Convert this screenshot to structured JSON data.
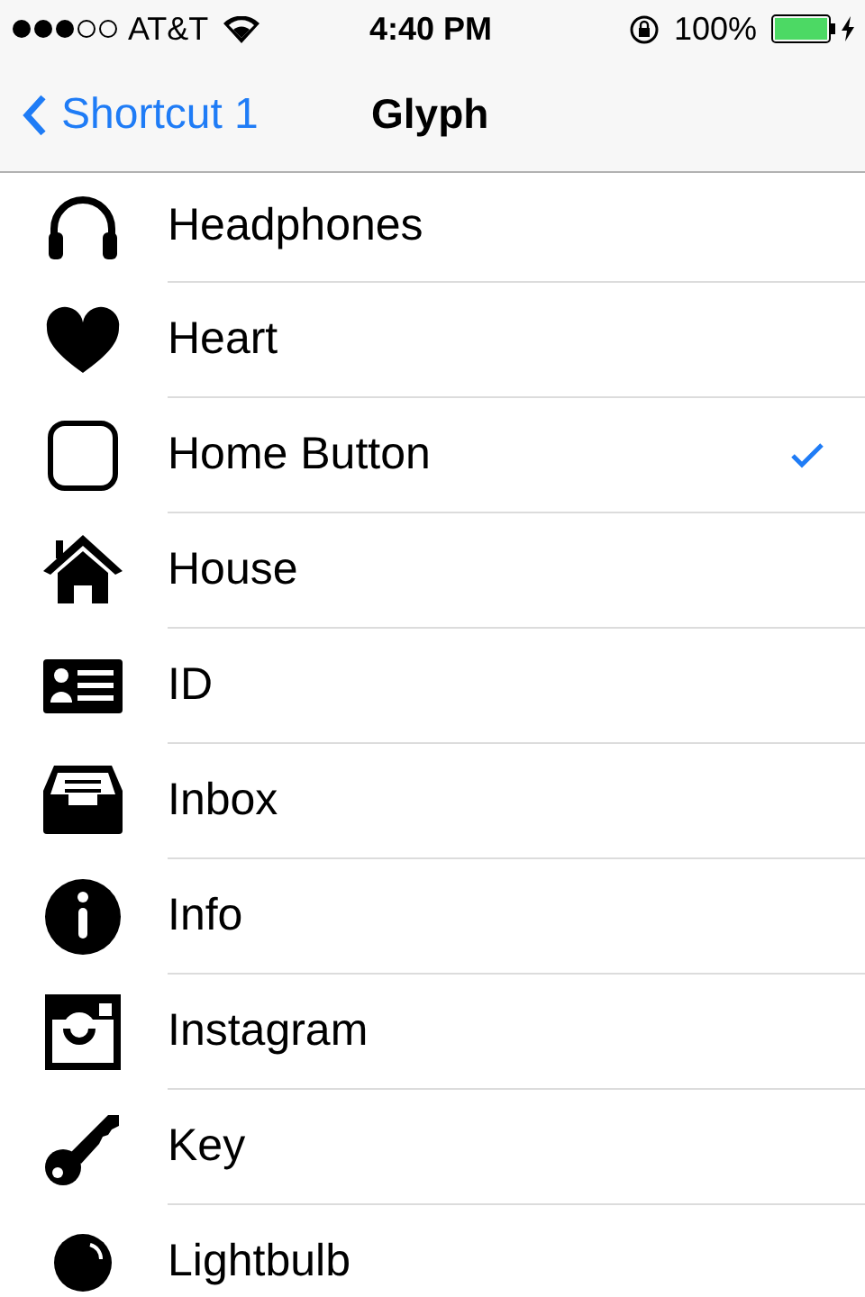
{
  "status_bar": {
    "carrier": "AT&T",
    "time": "4:40 PM",
    "battery": "100%",
    "charging": true,
    "rotation_lock": true
  },
  "nav_bar": {
    "back": "Shortcut 1",
    "title": "Glyph"
  },
  "items": [
    {
      "kind": "headphones",
      "label": "Headphones",
      "selected": false
    },
    {
      "kind": "heart",
      "label": "Heart",
      "selected": false
    },
    {
      "kind": "home_button",
      "label": "Home Button",
      "selected": true
    },
    {
      "kind": "house",
      "label": "House",
      "selected": false
    },
    {
      "kind": "id",
      "label": "ID",
      "selected": false
    },
    {
      "kind": "inbox",
      "label": "Inbox",
      "selected": false
    },
    {
      "kind": "info",
      "label": "Info",
      "selected": false
    },
    {
      "kind": "instagram",
      "label": "Instagram",
      "selected": false
    },
    {
      "kind": "key",
      "label": "Key",
      "selected": false
    },
    {
      "kind": "lightbulb",
      "label": "Lightbulb",
      "selected": false
    }
  ]
}
